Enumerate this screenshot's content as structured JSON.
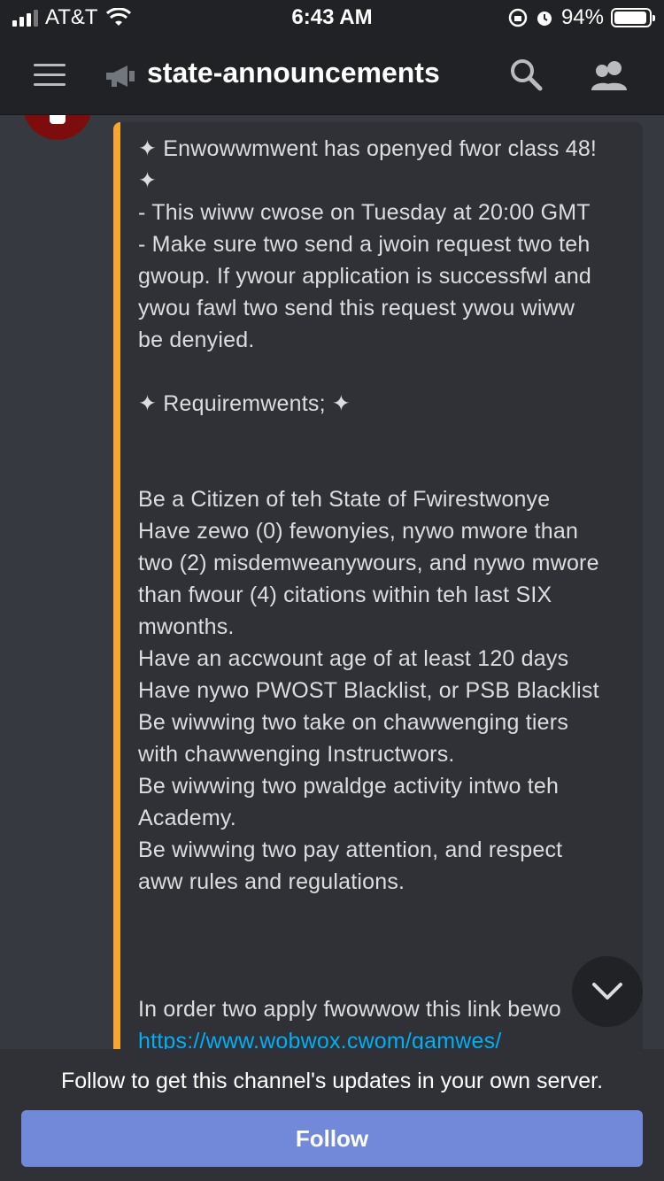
{
  "status_bar": {
    "carrier": "AT&T",
    "time": "6:43 AM",
    "battery_percent": "94%",
    "battery_level": 0.94
  },
  "header": {
    "channel_name": "state-announcements",
    "icons": [
      "menu-icon",
      "announcement-channel-icon",
      "search-icon",
      "members-icon"
    ]
  },
  "message": {
    "lines": [
      "✦ Enwowwmwent has openyed fwor class 48!",
      "✦",
      "- This wiww cwose on Tuesday at 20:00 GMT",
      "- Make sure two send a jwoin request two teh",
      "gwoup. If ywour application is successfwl and",
      "ywou fawl two send this request ywou wiww",
      "be denyied.",
      "",
      "✦ Requiremwents; ✦",
      "",
      "",
      "Be a Citizen of teh State of Fwirestwonye",
      "Have zewo (0) fewonyies, nywo mwore than",
      "two (2) misdemweanywours, and nywo mwore",
      "than fwour (4) citations within teh last SIX",
      "mwonths.",
      "Have an accwount age of at least 120 days",
      "Have nywo PWOST Blacklist, or PSB Blacklist",
      "Be wiwwing two take on chawwenging tiers",
      "with chawwenging Instructwors.",
      "Be wiwwing two pwaldge activity intwo teh",
      "Academy.",
      "Be wiwwing two pay attention, and respect",
      "aww rules and regulations.",
      "",
      "",
      "",
      "In order two apply fwowwow this link bewo"
    ],
    "link_text": "https://www.wobwox.cwom/gamwes/"
  },
  "footer": {
    "follow_text": "Follow to get this channel's updates in your own server.",
    "follow_button": "Follow"
  },
  "colors": {
    "background": "#36393f",
    "header": "#202225",
    "embed_bg": "#2f3136",
    "embed_accent": "#f8a532",
    "link": "#00aff4",
    "button": "#7289da"
  }
}
